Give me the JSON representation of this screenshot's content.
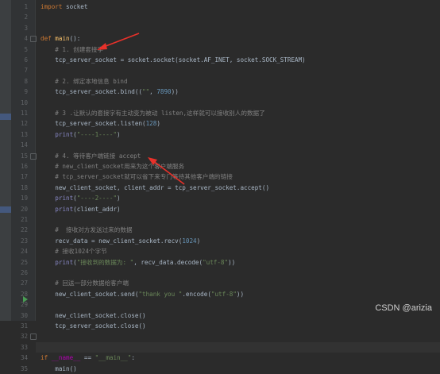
{
  "editor": {
    "lines": [
      {
        "num": "1",
        "tokens": [
          {
            "t": "keyword",
            "v": "import"
          },
          {
            "t": "text",
            "v": " socket"
          }
        ]
      },
      {
        "num": "2",
        "tokens": []
      },
      {
        "num": "3",
        "tokens": []
      },
      {
        "num": "4",
        "tokens": [
          {
            "t": "keyword",
            "v": "def"
          },
          {
            "t": "text",
            "v": " "
          },
          {
            "t": "func",
            "v": "main"
          },
          {
            "t": "text",
            "v": "():"
          }
        ]
      },
      {
        "num": "5",
        "tokens": [
          {
            "t": "comment",
            "v": "    # 1. 创建套接字"
          }
        ]
      },
      {
        "num": "6",
        "tokens": [
          {
            "t": "text",
            "v": "    tcp_server_socket = socket.socket(socket.AF_INET, socket.SOCK_STREAM)"
          }
        ]
      },
      {
        "num": "7",
        "tokens": []
      },
      {
        "num": "8",
        "tokens": [
          {
            "t": "comment",
            "v": "    # 2. 绑定本地信息 bind"
          }
        ]
      },
      {
        "num": "9",
        "tokens": [
          {
            "t": "text",
            "v": "    tcp_server_socket.bind(("
          },
          {
            "t": "string",
            "v": "\"\""
          },
          {
            "t": "text",
            "v": ", "
          },
          {
            "t": "number",
            "v": "7890"
          },
          {
            "t": "text",
            "v": "))"
          }
        ]
      },
      {
        "num": "10",
        "tokens": []
      },
      {
        "num": "11",
        "tokens": [
          {
            "t": "comment",
            "v": "    # 3 .让默认的套接字有主动变为被动 listen,这样就可以接收别人的数据了"
          }
        ]
      },
      {
        "num": "12",
        "tokens": [
          {
            "t": "text",
            "v": "    tcp_server_socket.listen("
          },
          {
            "t": "number",
            "v": "128"
          },
          {
            "t": "text",
            "v": ")"
          }
        ]
      },
      {
        "num": "13",
        "tokens": [
          {
            "t": "text",
            "v": "    "
          },
          {
            "t": "builtin",
            "v": "print"
          },
          {
            "t": "text",
            "v": "("
          },
          {
            "t": "string",
            "v": "\"----1----\""
          },
          {
            "t": "text",
            "v": ")"
          }
        ]
      },
      {
        "num": "14",
        "tokens": []
      },
      {
        "num": "15",
        "tokens": [
          {
            "t": "comment",
            "v": "    # 4. 等待客户端链接 accept"
          }
        ]
      },
      {
        "num": "16",
        "tokens": [
          {
            "t": "comment",
            "v": "    # new_client_socket用来为这个客户端服务"
          }
        ]
      },
      {
        "num": "17",
        "tokens": [
          {
            "t": "comment",
            "v": "    # tcp_server_socket就可以省下来专门等待其他客户端的链接"
          }
        ]
      },
      {
        "num": "18",
        "tokens": [
          {
            "t": "text",
            "v": "    new_client_socket, client_addr = tcp_server_socket.accept()"
          }
        ]
      },
      {
        "num": "19",
        "tokens": [
          {
            "t": "text",
            "v": "    "
          },
          {
            "t": "builtin",
            "v": "print"
          },
          {
            "t": "text",
            "v": "("
          },
          {
            "t": "string",
            "v": "\"----2----\""
          },
          {
            "t": "text",
            "v": ")"
          }
        ]
      },
      {
        "num": "20",
        "tokens": [
          {
            "t": "text",
            "v": "    "
          },
          {
            "t": "builtin",
            "v": "print"
          },
          {
            "t": "text",
            "v": "(client_addr)"
          }
        ]
      },
      {
        "num": "21",
        "tokens": []
      },
      {
        "num": "22",
        "tokens": [
          {
            "t": "comment",
            "v": "    #  接收对方发送过来的数据"
          }
        ]
      },
      {
        "num": "23",
        "tokens": [
          {
            "t": "text",
            "v": "    recv_data = new_client_socket.recv("
          },
          {
            "t": "number",
            "v": "1024"
          },
          {
            "t": "text",
            "v": ")"
          }
        ]
      },
      {
        "num": "24",
        "tokens": [
          {
            "t": "comment",
            "v": "    # 接收1024个字节"
          }
        ]
      },
      {
        "num": "25",
        "tokens": [
          {
            "t": "text",
            "v": "    "
          },
          {
            "t": "builtin",
            "v": "print"
          },
          {
            "t": "text",
            "v": "("
          },
          {
            "t": "string",
            "v": "\"接收到的数据为: \""
          },
          {
            "t": "text",
            "v": ", recv_data.decode("
          },
          {
            "t": "string",
            "v": "\"utf-8\""
          },
          {
            "t": "text",
            "v": "))"
          }
        ]
      },
      {
        "num": "26",
        "tokens": []
      },
      {
        "num": "27",
        "tokens": [
          {
            "t": "comment",
            "v": "    # 回送一部分数据给客户端"
          }
        ]
      },
      {
        "num": "28",
        "tokens": [
          {
            "t": "text",
            "v": "    new_client_socket.send("
          },
          {
            "t": "string",
            "v": "\"thank you \""
          },
          {
            "t": "text",
            "v": ".encode("
          },
          {
            "t": "string",
            "v": "\"utf-8\""
          },
          {
            "t": "text",
            "v": "))"
          }
        ]
      },
      {
        "num": "29",
        "tokens": []
      },
      {
        "num": "30",
        "tokens": [
          {
            "t": "text",
            "v": "    new_client_socket.close()"
          }
        ]
      },
      {
        "num": "31",
        "tokens": [
          {
            "t": "text",
            "v": "    tcp_server_socket.close()"
          }
        ]
      },
      {
        "num": "32",
        "tokens": []
      },
      {
        "num": "33",
        "tokens": []
      },
      {
        "num": "34",
        "tokens": [
          {
            "t": "keyword",
            "v": "if"
          },
          {
            "t": "text",
            "v": " "
          },
          {
            "t": "dunder",
            "v": "__name__"
          },
          {
            "t": "text",
            "v": " == "
          },
          {
            "t": "string",
            "v": "\"__main__\""
          },
          {
            "t": "text",
            "v": ":"
          }
        ]
      },
      {
        "num": "35",
        "tokens": [
          {
            "t": "text",
            "v": "    main()"
          }
        ]
      }
    ]
  },
  "watermark": "CSDN @arizia",
  "colors": {
    "background": "#2b2b2b",
    "gutter": "#313335",
    "annotation_arrow": "#e8312a"
  }
}
